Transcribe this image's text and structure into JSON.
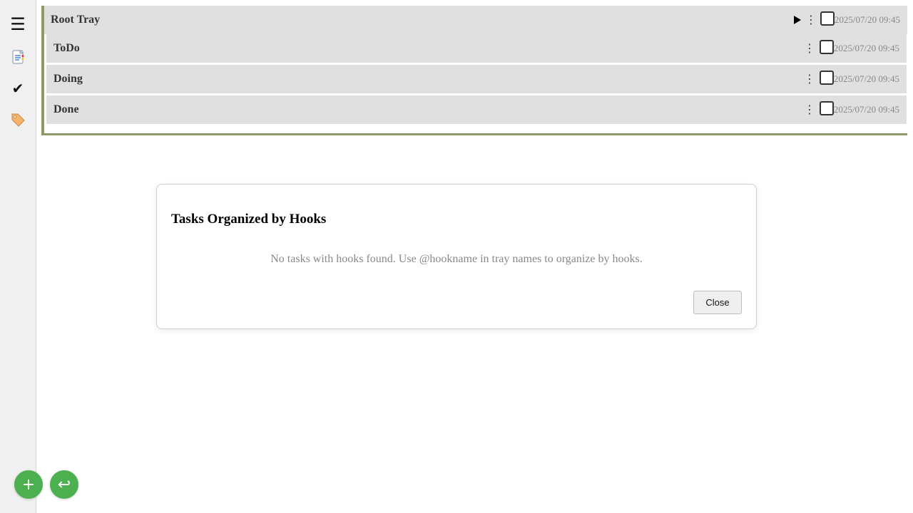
{
  "sidebar": {
    "items": [
      {
        "icon": "menu-icon",
        "glyph": "☰"
      },
      {
        "icon": "document-icon"
      },
      {
        "icon": "checkmark-icon",
        "glyph": "✔"
      },
      {
        "icon": "tag-icon"
      }
    ]
  },
  "root_tray": {
    "title": "Root Tray",
    "timestamp": "2025/07/20 09:45",
    "menu_glyph": "⋮"
  },
  "child_trays": [
    {
      "title": "ToDo",
      "timestamp": "2025/07/20 09:45"
    },
    {
      "title": "Doing",
      "timestamp": "2025/07/20 09:45"
    },
    {
      "title": "Done",
      "timestamp": "2025/07/20 09:45"
    }
  ],
  "dialog": {
    "title": "Tasks Organized by Hooks",
    "message": "No tasks with hooks found. Use @hookname in tray names to organize by hooks.",
    "close_label": "Close"
  },
  "fabs": {
    "add_glyph": "+",
    "back_glyph": "↩"
  },
  "colors": {
    "tray_border": "#8c9a6a",
    "tray_background": "#e0e0e0",
    "fab_green": "#4caf50"
  }
}
